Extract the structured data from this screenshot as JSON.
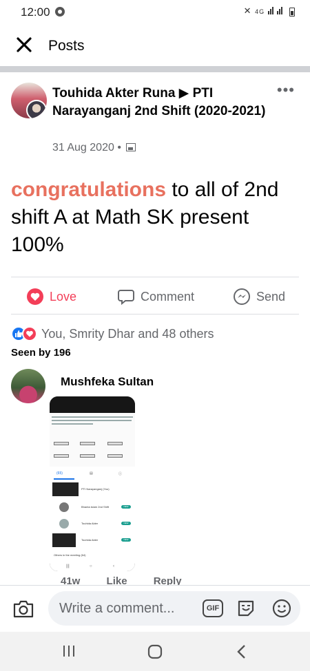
{
  "status_bar": {
    "time": "12:00",
    "network": "4G"
  },
  "header": {
    "title": "Posts"
  },
  "post": {
    "author_line": "Touhida Akter Runa ▶ PTI Narayanganj  2nd Shift (2020-2021)",
    "date": "31 Aug 2020",
    "separator": "•",
    "text_highlight": "congratulations",
    "text_rest": " to all of 2nd shift A at Math SK present 100%",
    "actions": {
      "love": "Love",
      "comment": "Comment",
      "send": "Send"
    },
    "reactions_text": "You, Smrity Dhar and 48 others",
    "seen_by": "Seen by 196"
  },
  "comment": {
    "author": "Mushfeka Sultan",
    "actions": {
      "time": "41w",
      "like": "Like",
      "reply": "Reply"
    },
    "attachment": {
      "group_title": "PTI Narayanganj (You)",
      "participants": [
        {
          "name": "Bhanta islam 2nd Shift",
          "badge": "NEW"
        },
        {
          "name": "Touhida Akter",
          "badge": "NEW"
        },
        {
          "name": "Touhida Akter",
          "badge": "NEW"
        }
      ],
      "others_label": "Others in the meeting (64)",
      "tab_count": "(65)"
    }
  },
  "composer": {
    "placeholder": "Write a comment...",
    "gif_label": "GIF"
  },
  "colors": {
    "love": "#f33e58",
    "like": "#1877f2",
    "highlight": "#e8715f",
    "muted": "#65676b"
  },
  "icons": [
    "close-icon",
    "more-icon",
    "love-icon",
    "comment-icon",
    "messenger-icon",
    "camera-icon",
    "gif-icon",
    "sticker-icon",
    "emoji-icon",
    "recents-icon",
    "home-icon",
    "back-icon"
  ]
}
